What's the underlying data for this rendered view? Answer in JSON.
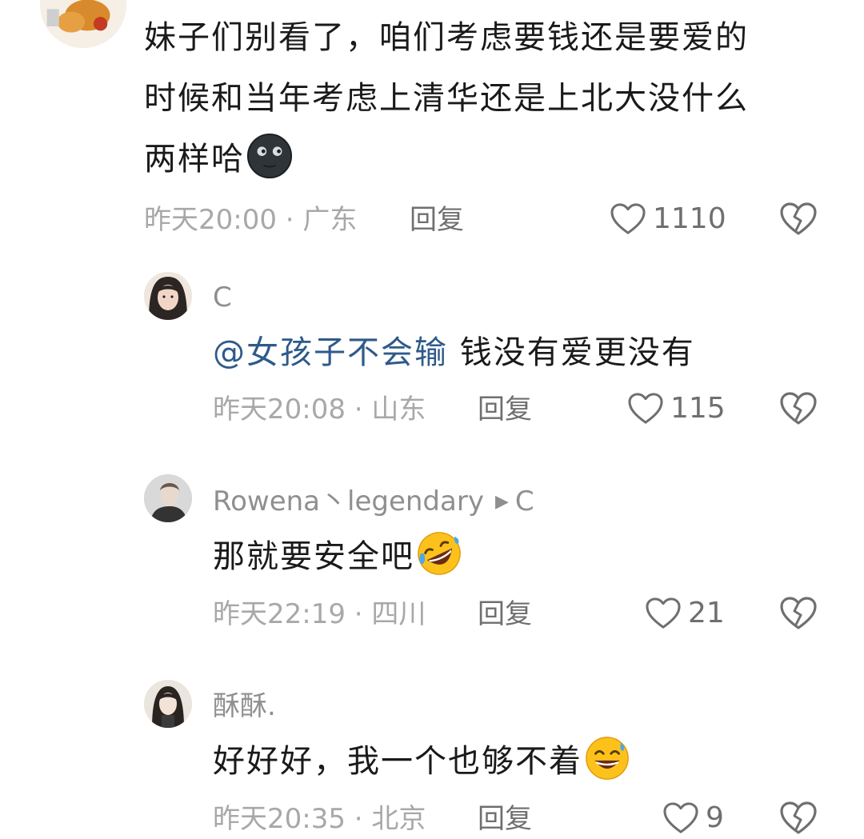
{
  "comments": [
    {
      "lines": [
        "妹子们别看了，咱们考虑要钱还是要爱的",
        "时候和当年考虑上清华还是上北大没什么",
        "两样哈"
      ],
      "emoji": "new-moon-face-emoji",
      "time": "昨天20:00",
      "location": "广东",
      "reply_label": "回复",
      "likes": "1110"
    },
    {
      "name": "C",
      "mention": "@女孩子不会输",
      "text": "钱没有爱更没有",
      "time": "昨天20:08",
      "location": "山东",
      "reply_label": "回复",
      "likes": "115"
    },
    {
      "name": "Rowena丶legendary",
      "reply_to": "C",
      "text": "那就要安全吧",
      "emoji": "rolling-laughing-emoji",
      "time": "昨天22:19",
      "location": "四川",
      "reply_label": "回复",
      "likes": "21"
    },
    {
      "name": "酥酥.",
      "text": "好好好，我一个也够不着",
      "emoji": "grinning-sweat-emoji",
      "time": "昨天20:35",
      "location": "北京",
      "reply_label": "回复",
      "likes": "9"
    }
  ],
  "separator": " · ",
  "icons": {
    "like": "heart-outline-icon",
    "dislike": "broken-heart-icon"
  },
  "colors": {
    "text": "#1a1a1a",
    "meta": "#a8a8a8",
    "mention": "#2e5a8a"
  }
}
